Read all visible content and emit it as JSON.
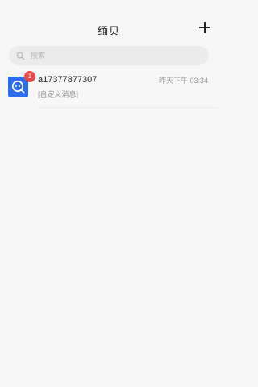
{
  "header": {
    "title": "缅贝",
    "add_icon": "plus-icon"
  },
  "search": {
    "placeholder": "搜索",
    "icon": "search-icon"
  },
  "conversations": [
    {
      "name": "a17377877307",
      "time": "昨天下午 03:34",
      "preview": "[自定义消息]",
      "unread": "1",
      "avatar_icon": "chat-bubble-icon",
      "avatar_color": "#2d6df2",
      "badge_color": "#e94a4a"
    }
  ]
}
